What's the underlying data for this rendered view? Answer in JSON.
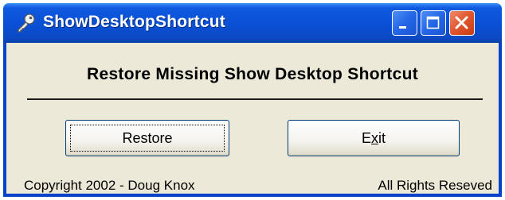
{
  "window": {
    "title": "ShowDesktopShortcut",
    "icon": "key-icon",
    "controls": {
      "minimize_icon": "minimize-icon",
      "maximize_icon": "maximize-icon",
      "close_icon": "close-icon"
    }
  },
  "main": {
    "heading": "Restore Missing Show Desktop Shortcut",
    "restore_button": "Restore",
    "exit_button": {
      "before": "E",
      "accel": "x",
      "after": "it"
    }
  },
  "footer": {
    "copyright": "Copyright 2002 - Doug Knox",
    "rights": "All Rights Reseved"
  },
  "colors": {
    "titlebar": "#0a4fd4",
    "client_bg": "#ece9d8",
    "close_button": "#e1552c"
  }
}
